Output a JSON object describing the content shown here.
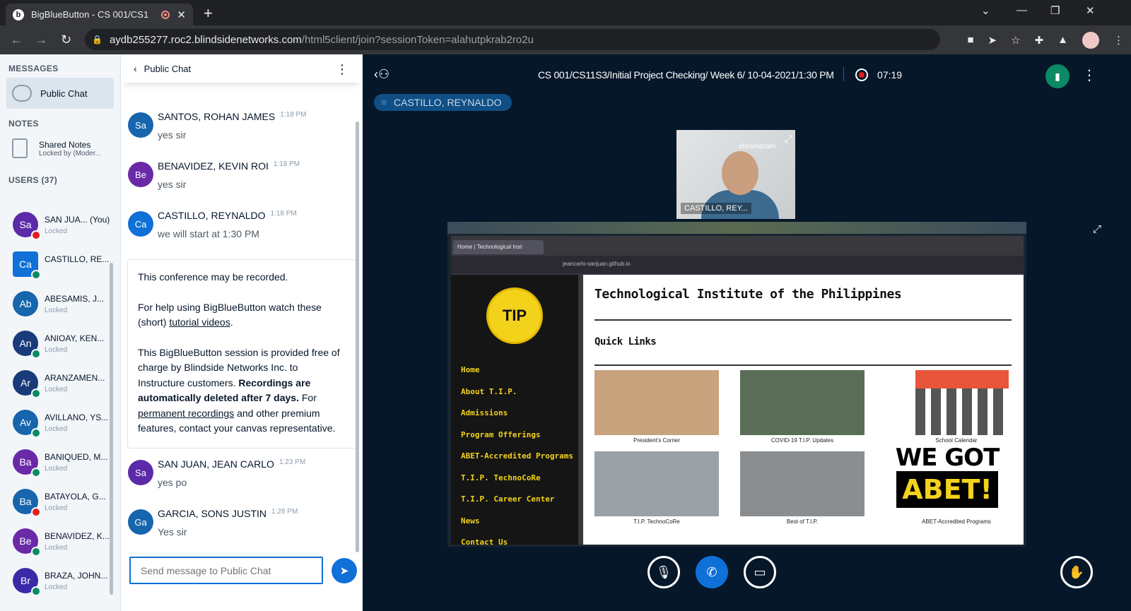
{
  "browser": {
    "tab_title": "BigBlueButton - CS 001/CS1",
    "favicon_letter": "b",
    "url_host": "aydb255277.roc2.blindsidenetworks.com",
    "url_path": "/html5client/join?sessionToken=alahutpkrab2ro2u"
  },
  "left": {
    "messages_heading": "MESSAGES",
    "public_chat": "Public Chat",
    "notes_heading": "NOTES",
    "shared_notes": "Shared Notes",
    "shared_notes_status": "Locked by (Moder...",
    "users_heading": "USERS (37)",
    "users": [
      {
        "initials": "Sa",
        "name": "SAN JUA... (You)",
        "status": "Locked",
        "color": "#5b2aa8",
        "badge": "#e51d1d",
        "moderator": false
      },
      {
        "initials": "Ca",
        "name": "CASTILLO, RE...",
        "status": "",
        "color": "#0f70d7",
        "badge": "#0a8a65",
        "moderator": true
      },
      {
        "initials": "Ab",
        "name": "ABESAMIS, J...",
        "status": "Locked",
        "color": "#1665ad",
        "badge": "",
        "moderator": false
      },
      {
        "initials": "An",
        "name": "ANIOAY, KEN...",
        "status": "Locked",
        "color": "#1a3b7a",
        "badge": "#0a8a65",
        "moderator": false
      },
      {
        "initials": "Ar",
        "name": "ARANZAMEN...",
        "status": "Locked",
        "color": "#1a3b7a",
        "badge": "#0a8a65",
        "moderator": false
      },
      {
        "initials": "Av",
        "name": "AVILLANO, YS...",
        "status": "Locked",
        "color": "#1665ad",
        "badge": "#0a8a65",
        "moderator": false
      },
      {
        "initials": "Ba",
        "name": "BANIQUED, M...",
        "status": "Locked",
        "color": "#6a2aa8",
        "badge": "#0a8a65",
        "moderator": false
      },
      {
        "initials": "Ba",
        "name": "BATAYOLA, G...",
        "status": "Locked",
        "color": "#1665ad",
        "badge": "#e51d1d",
        "moderator": false
      },
      {
        "initials": "Be",
        "name": "BENAVIDEZ, K...",
        "status": "Locked",
        "color": "#6a2aa8",
        "badge": "#0a8a65",
        "moderator": false
      },
      {
        "initials": "Br",
        "name": "BRAZA, JOHN...",
        "status": "Locked",
        "color": "#3b2aa8",
        "badge": "#0a8a65",
        "moderator": false
      }
    ]
  },
  "chat": {
    "header": "Public Chat",
    "messages": [
      {
        "initials": "Sa",
        "name": "SANTOS, ROHAN JAMES",
        "time": "1:18 PM",
        "text": "yes sir",
        "color": "#1665ad"
      },
      {
        "initials": "Be",
        "name": "BENAVIDEZ, KEVIN ROI",
        "time": "1:18 PM",
        "text": "yes sir",
        "color": "#6a2aa8"
      },
      {
        "initials": "Ca",
        "name": "CASTILLO, REYNALDO",
        "time": "1:18 PM",
        "text": "we will start at 1:30 PM",
        "color": "#0f70d7"
      },
      {
        "initials": "Sa",
        "name": "SAN JUAN, JEAN CARLO",
        "time": "1:23 PM",
        "text": "yes po",
        "color": "#5b2aa8"
      },
      {
        "initials": "Ga",
        "name": "GARCIA, SONS JUSTIN",
        "time": "1:28 PM",
        "text": "Yes sir",
        "color": "#1665ad"
      }
    ],
    "system": {
      "p1": "This conference may be recorded.",
      "p2a": "For help using BigBlueButton watch these (short) ",
      "p2link": "tutorial videos",
      "p2b": ".",
      "p3a": "This BigBlueButton session is provided free of charge by Blindside Networks Inc. to Instructure customers. ",
      "p3bold": "Recordings are automatically deleted after 7 days.",
      "p3b": " For ",
      "p3link": "permanent recordings",
      "p3c": " and other premium features, contact your canvas representative."
    },
    "input_placeholder": "Send message to Public Chat"
  },
  "main": {
    "title": "CS 001/CS11S3/Initial Project Checking/ Week 6/ 10-04-2021/1:30 PM",
    "rec_time": "07:19",
    "talking": "CASTILLO, REYNALDO",
    "webcam_name": "CASTILLO, REY...",
    "webcam_watermark": "chromacam"
  },
  "screenshare": {
    "tab_title": "Home | Technological Inst",
    "url": "jeancarlo-sanjuan.github.io",
    "logo_text": "TIP",
    "site_title": "Technological Institute of the Philippines",
    "quick_links": "Quick Links",
    "nav": [
      "Home",
      "About T.I.P.",
      "Admissions",
      "Program Offerings",
      "ABET-Accredited Programs",
      "T.I.P. TechnoCoRe",
      "T.I.P. Career Center",
      "News",
      "Contact Us"
    ],
    "cards": [
      {
        "caption": "President's Corner",
        "color": "#c9a27e"
      },
      {
        "caption": "COVID-19 T.I.P. Updates",
        "color": "#5a6e57"
      },
      {
        "caption": "School Calendar",
        "color": "#ffffff"
      },
      {
        "caption": "T.I.P. TechnoCoRe",
        "color": "#9aa1a6"
      },
      {
        "caption": "Best of T.I.P.",
        "color": "#8b8e90"
      },
      {
        "caption": "ABET-Accredited Programs",
        "color": "#ffffff"
      }
    ],
    "abet_we": "WE GOT",
    "abet_word": "ABET!"
  }
}
